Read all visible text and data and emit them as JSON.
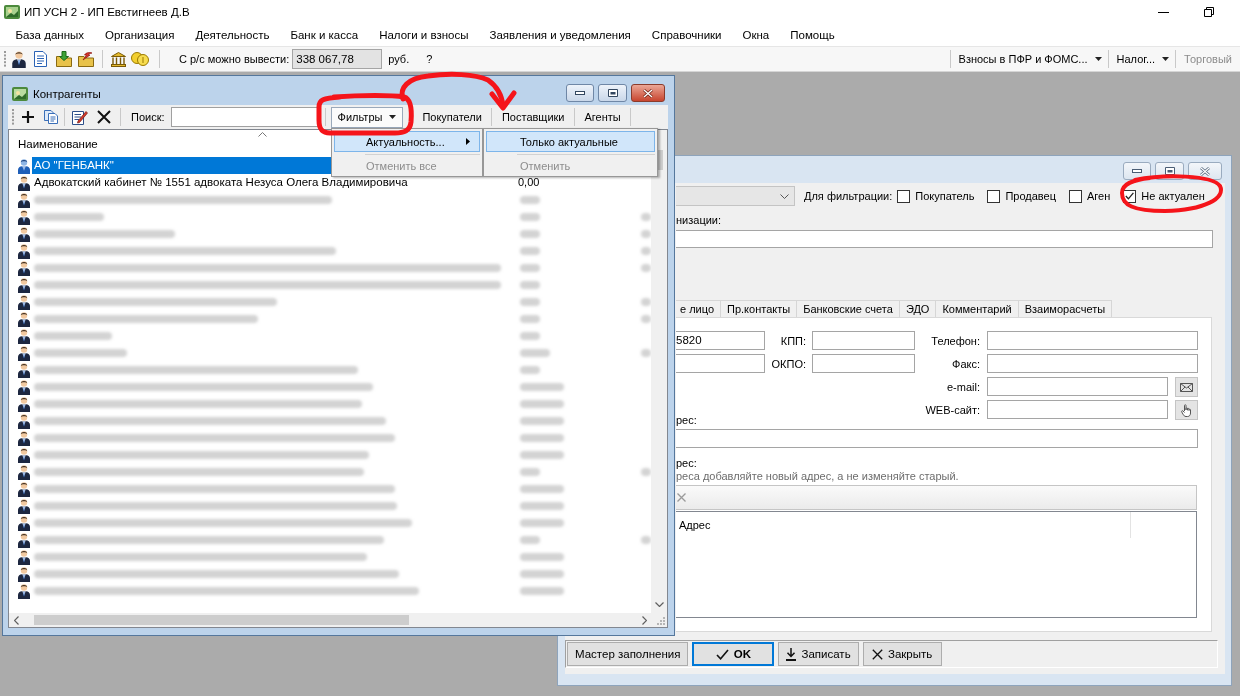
{
  "window": {
    "title": "ИП УСН 2 - ИП Евстигнеев Д.В"
  },
  "menu": [
    "База данных",
    "Организация",
    "Деятельность",
    "Банк и касса",
    "Налоги и взносы",
    "Заявления и уведомления",
    "Справочники",
    "Окна",
    "Помощь"
  ],
  "toolbar": {
    "balance_label": "С р/с можно вывести:",
    "balance_value": "338 067,78",
    "currency": "руб.",
    "help": "?",
    "right_items": [
      {
        "label": "Взносы в ПФР и ФОМС...",
        "kind": "dropdown",
        "disabled": false
      },
      {
        "label": "Налог...",
        "kind": "dropdown",
        "disabled": false
      },
      {
        "label": "Торговый",
        "kind": "button",
        "disabled": true
      }
    ]
  },
  "contractors": {
    "title": "Контрагенты",
    "search": {
      "label": "Поиск:"
    },
    "filters": [
      {
        "label": "Фильтры",
        "kind": "dropdown",
        "pressed": true
      },
      {
        "label": "Покупатели",
        "kind": "toggle",
        "pressed": false
      },
      {
        "label": "Поставщики",
        "kind": "toggle",
        "pressed": false
      },
      {
        "label": "Агенты",
        "kind": "toggle",
        "pressed": false
      }
    ],
    "columns": [
      "Наименование"
    ],
    "rows": [
      {
        "kind": "text",
        "name": "АО \"ГЕНБАНК\"",
        "selected": true
      },
      {
        "kind": "text",
        "name": "Адвокатский кабинет № 1551 адвоката Незуса Олега Владимировича",
        "amount": "0,00",
        "selected": false
      },
      {
        "kind": "blurred",
        "selected": false
      },
      {
        "kind": "blurred",
        "selected": false
      },
      {
        "kind": "blurred",
        "selected": false
      },
      {
        "kind": "blurred",
        "selected": false
      },
      {
        "kind": "blurred",
        "selected": false
      },
      {
        "kind": "blurred",
        "selected": false
      },
      {
        "kind": "blurred",
        "selected": false
      },
      {
        "kind": "blurred",
        "selected": false
      },
      {
        "kind": "blurred",
        "selected": false
      },
      {
        "kind": "blurred",
        "selected": false
      },
      {
        "kind": "blurred",
        "selected": false
      },
      {
        "kind": "blurred",
        "selected": false
      },
      {
        "kind": "blurred",
        "selected": false
      },
      {
        "kind": "blurred",
        "selected": false
      },
      {
        "kind": "blurred",
        "selected": false
      },
      {
        "kind": "blurred",
        "selected": false
      },
      {
        "kind": "blurred",
        "selected": false
      },
      {
        "kind": "blurred",
        "selected": false
      },
      {
        "kind": "blurred",
        "selected": false
      },
      {
        "kind": "blurred",
        "selected": false
      },
      {
        "kind": "blurred",
        "selected": false
      },
      {
        "kind": "blurred",
        "selected": false
      },
      {
        "kind": "blurred",
        "selected": false
      },
      {
        "kind": "blurred",
        "selected": false
      }
    ],
    "filter_menu": [
      {
        "kind": "submenu",
        "label": "Актуальность...",
        "selected": true,
        "disabled": false
      },
      {
        "kind": "separator"
      },
      {
        "kind": "item",
        "label": "Отменить все",
        "selected": false,
        "disabled": true
      }
    ],
    "submenu": [
      {
        "kind": "item",
        "label": "Только актуальные",
        "selected": true,
        "disabled": false
      },
      {
        "kind": "separator"
      },
      {
        "kind": "item",
        "label": "Отменить",
        "selected": false,
        "disabled": true
      }
    ]
  },
  "card": {
    "filter_label": "Для фильтрации:",
    "checkboxes": [
      {
        "label": "Покупатель",
        "checked": false
      },
      {
        "label": "Продавец",
        "checked": false
      },
      {
        "label": "Аген",
        "checked": false
      },
      {
        "label": "Не актуален",
        "checked": true
      }
    ],
    "name_label": "низации:",
    "tabs": [
      {
        "label": "е лицо",
        "selected": false
      },
      {
        "label": "Пр.контакты",
        "selected": false
      },
      {
        "label": "Банковские счета",
        "selected": false
      },
      {
        "label": "ЭДО",
        "selected": false
      },
      {
        "label": "Комментарий",
        "selected": false
      },
      {
        "label": "Взаиморасчеты",
        "selected": false
      }
    ],
    "requisites": [
      {
        "value": "5820",
        "code_label": "КПП:"
      },
      {
        "code_label": "ОКПО:"
      }
    ],
    "contacts": [
      {
        "label": "Телефон:",
        "kind": "plain"
      },
      {
        "label": "Факс:",
        "kind": "plain"
      },
      {
        "label": "e-mail:",
        "kind": "email"
      },
      {
        "label": "WEB-сайт:",
        "kind": "web"
      }
    ],
    "address_label": "рес:",
    "postal_label": "рес:",
    "postal_hint": "реса добавляйте новый адрес, а не изменяйте старый.",
    "address_columns": [
      "Адрес"
    ],
    "buttons": [
      {
        "label": "Мастер заполнения",
        "kind": "plain",
        "default": false
      },
      {
        "label": "OK",
        "kind": "ok",
        "default": true
      },
      {
        "label": "Записать",
        "kind": "save",
        "default": false
      },
      {
        "label": "Закрыть",
        "kind": "close",
        "default": false
      }
    ]
  },
  "annotations": [
    {
      "kind": "frame"
    },
    {
      "kind": "arrow"
    },
    {
      "kind": "ellipse"
    }
  ]
}
